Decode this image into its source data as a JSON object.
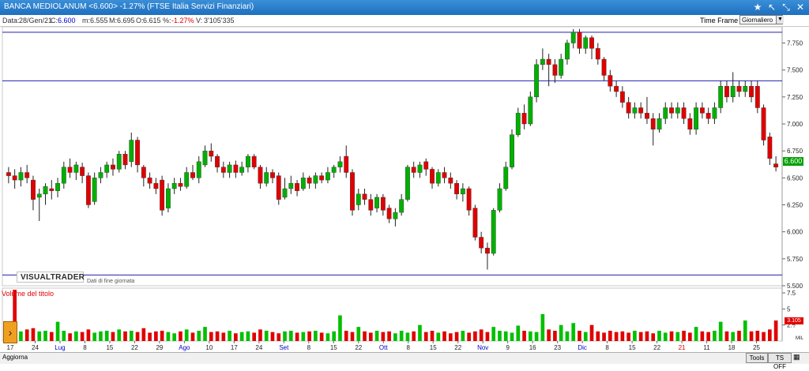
{
  "window": {
    "title": "BANCA MEDIOLANUM <6.600> -1.27%  (FTSE Italia Servizi Finanziari)",
    "icons": [
      "star-icon",
      "pin-icon",
      "restore-icon",
      "close-icon"
    ]
  },
  "info": {
    "data_label": "Data:",
    "data_value": "28/Gen/21",
    "c_label": "C:",
    "c_value": "6.600",
    "m_label": "m:",
    "m_value": "6.555",
    "M_label": "M:",
    "M_value": "6.695",
    "o_label": "O:",
    "o_value": "6.615",
    "pct_label": "%:",
    "pct_value": "-1.27%",
    "v_label": "V:",
    "v_value": "3'105'335"
  },
  "timeframe": {
    "label": "Time Frame",
    "selected": "Giornaliero"
  },
  "price_axis_labels": [
    "7.750",
    "7.500",
    "7.250",
    "7.000",
    "6.750",
    "6.500",
    "6.250",
    "6.000",
    "5.750",
    "5.500"
  ],
  "price_tag": "6.600",
  "volume_label": "Volume del titolo",
  "volume_axis_labels": [
    "7.5",
    "5",
    "2.5"
  ],
  "volume_tag": "3.105 M",
  "volume_unit": "MIL",
  "logo": "VISUALTRADER",
  "logo_sub": "Dati di fine giornata",
  "x_labels": [
    {
      "t": "17",
      "blue": false
    },
    {
      "t": "24",
      "blue": false
    },
    {
      "t": "Lug",
      "blue": true
    },
    {
      "t": "8",
      "blue": false
    },
    {
      "t": "15",
      "blue": false
    },
    {
      "t": "22",
      "blue": false
    },
    {
      "t": "29",
      "blue": false
    },
    {
      "t": "Ago",
      "blue": true
    },
    {
      "t": "10",
      "blue": false
    },
    {
      "t": "17",
      "blue": false
    },
    {
      "t": "24",
      "blue": false
    },
    {
      "t": "Set",
      "blue": true
    },
    {
      "t": "8",
      "blue": false
    },
    {
      "t": "15",
      "blue": false
    },
    {
      "t": "22",
      "blue": false
    },
    {
      "t": "Ott",
      "blue": true
    },
    {
      "t": "8",
      "blue": false
    },
    {
      "t": "15",
      "blue": false
    },
    {
      "t": "22",
      "blue": false
    },
    {
      "t": "Nov",
      "blue": true
    },
    {
      "t": "9",
      "blue": false
    },
    {
      "t": "16",
      "blue": false
    },
    {
      "t": "23",
      "blue": false
    },
    {
      "t": "Dic",
      "blue": true
    },
    {
      "t": "8",
      "blue": false
    },
    {
      "t": "15",
      "blue": false
    },
    {
      "t": "22",
      "blue": false
    },
    {
      "t": "21",
      "blue": false,
      "red": true
    },
    {
      "t": "11",
      "blue": false
    },
    {
      "t": "18",
      "blue": false
    },
    {
      "t": "25",
      "blue": false
    }
  ],
  "bottom": {
    "aggiorna": "Aggiorna",
    "tools": "Tools",
    "ts_off": "TS OFF"
  },
  "chart_data": {
    "type": "candlestick",
    "ylim": [
      5.5,
      7.9
    ],
    "hlines": [
      7.85,
      7.4,
      5.6
    ],
    "candles": [
      [
        6.55,
        6.52,
        6.6,
        6.45
      ],
      [
        6.52,
        6.48,
        6.58,
        6.4
      ],
      [
        6.48,
        6.55,
        6.6,
        6.42
      ],
      [
        6.55,
        6.5,
        6.62,
        6.45
      ],
      [
        6.48,
        6.3,
        6.52,
        6.2
      ],
      [
        6.32,
        6.35,
        6.4,
        6.1
      ],
      [
        6.35,
        6.42,
        6.45,
        6.25
      ],
      [
        6.4,
        6.38,
        6.48,
        6.3
      ],
      [
        6.38,
        6.45,
        6.5,
        6.32
      ],
      [
        6.45,
        6.6,
        6.65,
        6.4
      ],
      [
        6.6,
        6.55,
        6.68,
        6.5
      ],
      [
        6.55,
        6.62,
        6.65,
        6.48
      ],
      [
        6.6,
        6.52,
        6.64,
        6.45
      ],
      [
        6.52,
        6.25,
        6.55,
        6.22
      ],
      [
        6.28,
        6.5,
        6.55,
        6.25
      ],
      [
        6.5,
        6.55,
        6.6,
        6.45
      ],
      [
        6.55,
        6.62,
        6.65,
        6.5
      ],
      [
        6.62,
        6.58,
        6.68,
        6.52
      ],
      [
        6.58,
        6.72,
        6.75,
        6.55
      ],
      [
        6.72,
        6.62,
        6.75,
        6.58
      ],
      [
        6.65,
        6.85,
        6.92,
        6.6
      ],
      [
        6.85,
        6.62,
        6.88,
        6.55
      ],
      [
        6.6,
        6.5,
        6.62,
        6.42
      ],
      [
        6.5,
        6.45,
        6.55,
        6.4
      ],
      [
        6.45,
        6.4,
        6.5,
        6.35
      ],
      [
        6.48,
        6.2,
        6.52,
        6.15
      ],
      [
        6.22,
        6.4,
        6.45,
        6.18
      ],
      [
        6.4,
        6.45,
        6.5,
        6.35
      ],
      [
        6.45,
        6.42,
        6.5,
        6.38
      ],
      [
        6.42,
        6.55,
        6.6,
        6.4
      ],
      [
        6.55,
        6.5,
        6.62,
        6.48
      ],
      [
        6.5,
        6.65,
        6.7,
        6.45
      ],
      [
        6.62,
        6.75,
        6.8,
        6.6
      ],
      [
        6.75,
        6.7,
        6.82,
        6.65
      ],
      [
        6.7,
        6.6,
        6.72,
        6.55
      ],
      [
        6.6,
        6.55,
        6.65,
        6.5
      ],
      [
        6.55,
        6.62,
        6.65,
        6.5
      ],
      [
        6.62,
        6.55,
        6.66,
        6.5
      ],
      [
        6.55,
        6.6,
        6.65,
        6.52
      ],
      [
        6.6,
        6.7,
        6.72,
        6.55
      ],
      [
        6.7,
        6.6,
        6.72,
        6.58
      ],
      [
        6.6,
        6.45,
        6.62,
        6.4
      ],
      [
        6.45,
        6.55,
        6.6,
        6.42
      ],
      [
        6.55,
        6.5,
        6.58,
        6.45
      ],
      [
        6.52,
        6.3,
        6.55,
        6.25
      ],
      [
        6.32,
        6.4,
        6.5,
        6.3
      ],
      [
        6.4,
        6.45,
        6.52,
        6.35
      ],
      [
        6.45,
        6.38,
        6.48,
        6.33
      ],
      [
        6.4,
        6.5,
        6.55,
        6.38
      ],
      [
        6.5,
        6.45,
        6.52,
        6.4
      ],
      [
        6.45,
        6.52,
        6.55,
        6.4
      ],
      [
        6.52,
        6.48,
        6.55,
        6.45
      ],
      [
        6.48,
        6.55,
        6.6,
        6.45
      ],
      [
        6.55,
        6.6,
        6.62,
        6.5
      ],
      [
        6.6,
        6.65,
        6.7,
        6.55
      ],
      [
        6.7,
        6.55,
        6.8,
        6.5
      ],
      [
        6.55,
        6.2,
        6.58,
        6.15
      ],
      [
        6.25,
        6.35,
        6.4,
        6.2
      ],
      [
        6.35,
        6.3,
        6.4,
        6.25
      ],
      [
        6.3,
        6.2,
        6.35,
        6.15
      ],
      [
        6.22,
        6.32,
        6.35,
        6.18
      ],
      [
        6.32,
        6.2,
        6.35,
        6.15
      ],
      [
        6.22,
        6.12,
        6.25,
        6.08
      ],
      [
        6.12,
        6.18,
        6.22,
        6.05
      ],
      [
        6.18,
        6.3,
        6.35,
        6.15
      ],
      [
        6.3,
        6.6,
        6.62,
        6.28
      ],
      [
        6.6,
        6.55,
        6.65,
        6.5
      ],
      [
        6.55,
        6.62,
        6.65,
        6.5
      ],
      [
        6.65,
        6.58,
        6.68,
        6.52
      ],
      [
        6.58,
        6.45,
        6.6,
        6.4
      ],
      [
        6.45,
        6.55,
        6.58,
        6.42
      ],
      [
        6.55,
        6.5,
        6.6,
        6.45
      ],
      [
        6.5,
        6.45,
        6.55,
        6.4
      ],
      [
        6.45,
        6.35,
        6.48,
        6.3
      ],
      [
        6.35,
        6.4,
        6.45,
        6.28
      ],
      [
        6.4,
        6.2,
        6.42,
        6.15
      ],
      [
        6.22,
        5.95,
        6.25,
        5.92
      ],
      [
        5.95,
        5.85,
        6.0,
        5.8
      ],
      [
        5.85,
        5.8,
        5.9,
        5.65
      ],
      [
        5.8,
        6.2,
        6.22,
        5.78
      ],
      [
        6.2,
        6.4,
        6.45,
        6.18
      ],
      [
        6.4,
        6.6,
        6.65,
        6.38
      ],
      [
        6.6,
        6.9,
        6.95,
        6.58
      ],
      [
        6.9,
        7.1,
        7.15,
        6.88
      ],
      [
        7.1,
        7.0,
        7.18,
        6.95
      ],
      [
        7.0,
        7.25,
        7.3,
        6.98
      ],
      [
        7.25,
        7.55,
        7.6,
        7.2
      ],
      [
        7.55,
        7.6,
        7.7,
        7.5
      ],
      [
        7.6,
        7.55,
        7.65,
        7.35
      ],
      [
        7.55,
        7.45,
        7.6,
        7.38
      ],
      [
        7.45,
        7.6,
        7.65,
        7.42
      ],
      [
        7.6,
        7.75,
        7.78,
        7.55
      ],
      [
        7.75,
        7.85,
        7.88,
        7.7
      ],
      [
        7.85,
        7.7,
        7.88,
        7.65
      ],
      [
        7.7,
        7.8,
        7.82,
        7.65
      ],
      [
        7.8,
        7.7,
        7.82,
        7.6
      ],
      [
        7.7,
        7.6,
        7.75,
        7.55
      ],
      [
        7.6,
        7.45,
        7.62,
        7.4
      ],
      [
        7.45,
        7.35,
        7.5,
        7.3
      ],
      [
        7.35,
        7.3,
        7.4,
        7.25
      ],
      [
        7.3,
        7.2,
        7.35,
        7.15
      ],
      [
        7.2,
        7.1,
        7.25,
        7.05
      ],
      [
        7.1,
        7.15,
        7.2,
        7.05
      ],
      [
        7.15,
        7.1,
        7.2,
        7.05
      ],
      [
        7.1,
        7.05,
        7.25,
        7.0
      ],
      [
        7.05,
        6.95,
        7.1,
        6.8
      ],
      [
        6.95,
        7.05,
        7.1,
        6.92
      ],
      [
        7.05,
        7.15,
        7.2,
        7.0
      ],
      [
        7.15,
        7.1,
        7.2,
        7.05
      ],
      [
        7.1,
        7.15,
        7.2,
        7.05
      ],
      [
        7.15,
        7.05,
        7.2,
        7.0
      ],
      [
        7.05,
        6.95,
        7.1,
        6.9
      ],
      [
        6.95,
        7.15,
        7.2,
        6.9
      ],
      [
        7.15,
        7.1,
        7.2,
        7.05
      ],
      [
        7.1,
        7.05,
        7.15,
        7.0
      ],
      [
        7.05,
        7.15,
        7.2,
        7.0
      ],
      [
        7.15,
        7.35,
        7.4,
        7.1
      ],
      [
        7.35,
        7.25,
        7.4,
        7.2
      ],
      [
        7.25,
        7.35,
        7.48,
        7.2
      ],
      [
        7.35,
        7.3,
        7.4,
        7.25
      ],
      [
        7.3,
        7.35,
        7.4,
        7.25
      ],
      [
        7.35,
        7.25,
        7.4,
        7.2
      ],
      [
        7.35,
        7.15,
        7.4,
        7.1
      ],
      [
        7.15,
        6.85,
        7.18,
        6.8
      ],
      [
        6.88,
        6.68,
        6.92,
        6.62
      ],
      [
        6.63,
        6.6,
        6.7,
        6.56
      ]
    ],
    "volumes": [
      1.2,
      8.0,
      1.5,
      1.8,
      2.0,
      1.5,
      1.6,
      1.4,
      3.0,
      1.6,
      1.2,
      1.5,
      1.4,
      1.8,
      1.3,
      1.5,
      1.6,
      1.4,
      1.8,
      1.5,
      1.6,
      1.4,
      2.0,
      1.3,
      1.5,
      1.6,
      1.4,
      1.2,
      1.5,
      1.8,
      1.3,
      1.6,
      2.2,
      1.4,
      1.5,
      1.3,
      1.6,
      1.2,
      1.4,
      1.5,
      1.3,
      1.8,
      1.6,
      1.4,
      1.2,
      1.5,
      1.6,
      1.3,
      1.4,
      1.5,
      1.6,
      1.3,
      1.2,
      1.5,
      4.0,
      1.6,
      1.4,
      2.2,
      1.5,
      1.3,
      1.6,
      1.4,
      1.5,
      1.2,
      1.6,
      1.3,
      1.5,
      2.5,
      1.4,
      1.6,
      1.3,
      1.5,
      1.2,
      1.4,
      1.6,
      1.3,
      1.5,
      1.8,
      1.4,
      2.2,
      1.6,
      1.5,
      1.3,
      2.4,
      1.6,
      1.5,
      1.4,
      4.2,
      1.8,
      1.6,
      2.5,
      1.5,
      2.8,
      1.6,
      1.4,
      2.5,
      1.5,
      1.3,
      1.6,
      1.4,
      1.5,
      1.3,
      1.6,
      1.4,
      1.5,
      1.2,
      1.6,
      1.3,
      1.5,
      1.4,
      1.6,
      1.3,
      2.2,
      1.5,
      1.4,
      1.6,
      3.0,
      1.5,
      1.4,
      1.6,
      3.2,
      1.5,
      1.6,
      1.4,
      1.8,
      3.2
    ]
  }
}
